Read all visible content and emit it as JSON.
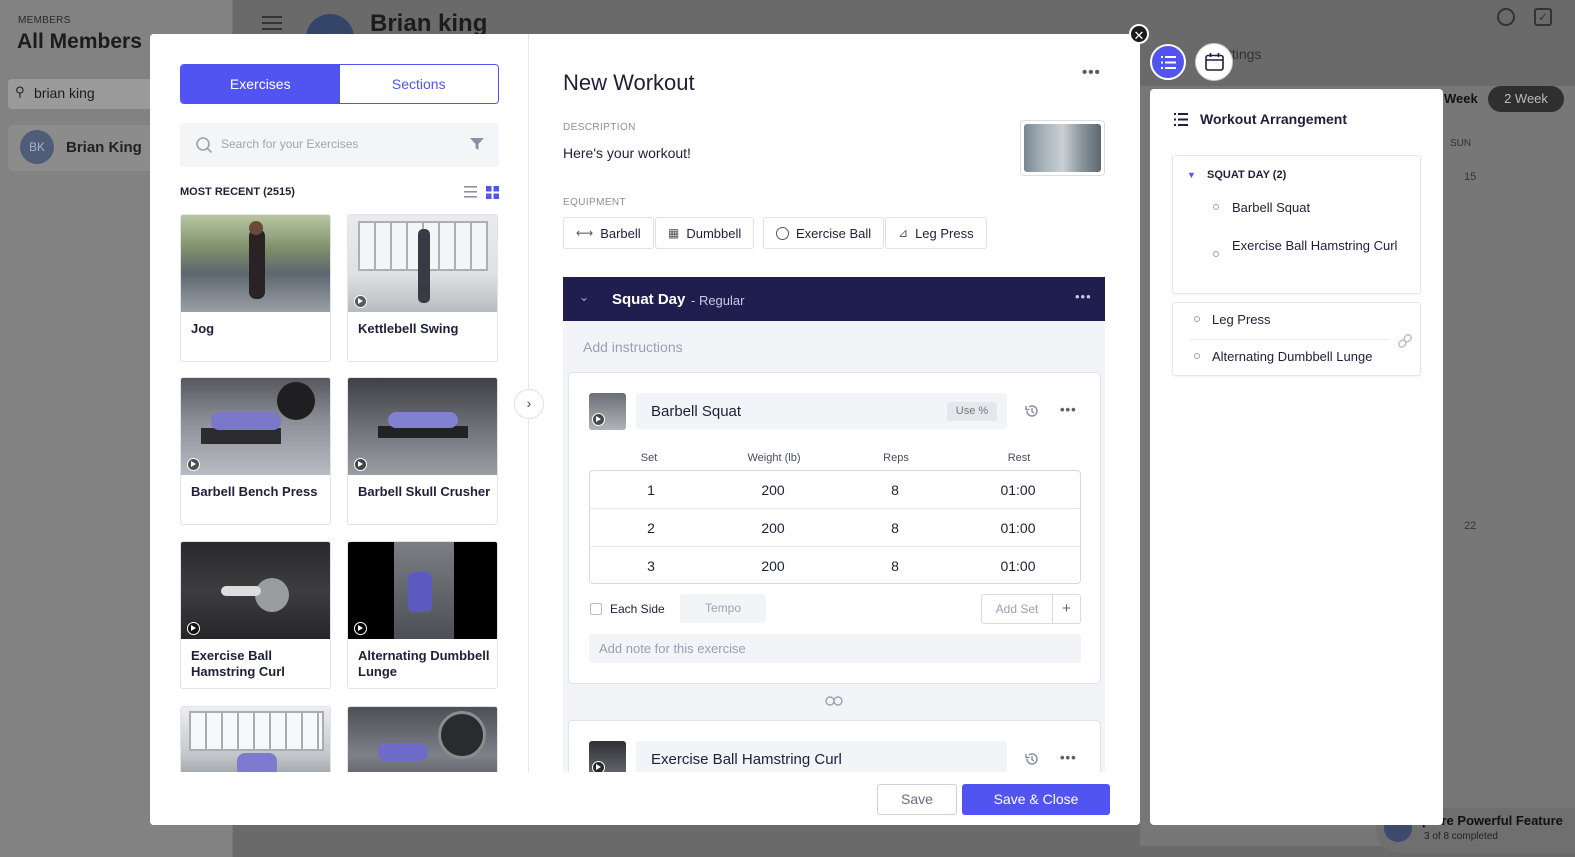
{
  "background": {
    "section_label": "MEMBERS",
    "page_title": "All Members",
    "search_value": "brian king",
    "member_initials": "BK",
    "member_name": "Brian King",
    "client_name": "Brian king",
    "tab_fragment": "ttings",
    "view_week": "Week",
    "view_2week": "2 Week",
    "day_sun": "SUN",
    "date_15": "15",
    "date_22": "22",
    "feature_title": "plore Powerful Feature",
    "feature_progress": "3 of 8 completed"
  },
  "library": {
    "tab_exercises": "Exercises",
    "tab_sections": "Sections",
    "search_placeholder": "Search for your Exercises",
    "most_recent": "MOST RECENT (2515)",
    "cards": [
      {
        "name": "Jog",
        "video": false
      },
      {
        "name": "Kettlebell Swing",
        "video": true
      },
      {
        "name": "Barbell Bench Press",
        "video": true
      },
      {
        "name": "Barbell Skull Crusher",
        "video": true
      },
      {
        "name": "Exercise Ball Hamstring Curl",
        "video": true
      },
      {
        "name": "Alternating Dumbbell Lunge",
        "video": true
      },
      {
        "name": "",
        "video": false
      },
      {
        "name": "",
        "video": false
      }
    ]
  },
  "editor": {
    "title": "New Workout",
    "description_label": "DESCRIPTION",
    "description": "Here's your workout!",
    "equipment_label": "EQUIPMENT",
    "equipment": [
      "Barbell",
      "Dumbbell",
      "Exercise Ball",
      "Leg Press"
    ],
    "section": {
      "name": "Squat Day",
      "type": "- Regular",
      "instructions_placeholder": "Add instructions"
    },
    "exercise1": {
      "name": "Barbell Squat",
      "use_pct": "Use %",
      "headers": [
        "Set",
        "Weight (lb)",
        "Reps",
        "Rest"
      ],
      "sets": [
        [
          "1",
          "200",
          "8",
          "01:00"
        ],
        [
          "2",
          "200",
          "8",
          "01:00"
        ],
        [
          "3",
          "200",
          "8",
          "01:00"
        ]
      ],
      "each_side": "Each Side",
      "tempo": "Tempo",
      "add_set": "Add Set",
      "plus": "+",
      "note_placeholder": "Add note for this exercise"
    },
    "exercise2": {
      "name": "Exercise Ball Hamstring Curl"
    },
    "save": "Save",
    "save_close": "Save & Close"
  },
  "arrangement": {
    "title": "Workout Arrangement",
    "group_label": "SQUAT DAY (2)",
    "group_items": [
      "Barbell Squat",
      "Exercise Ball Hamstring Curl"
    ],
    "loose_items": [
      "Leg Press",
      "Alternating Dumbbell Lunge"
    ]
  },
  "colors": {
    "accent": "#5154f0",
    "section_header": "#1f1e4e"
  }
}
